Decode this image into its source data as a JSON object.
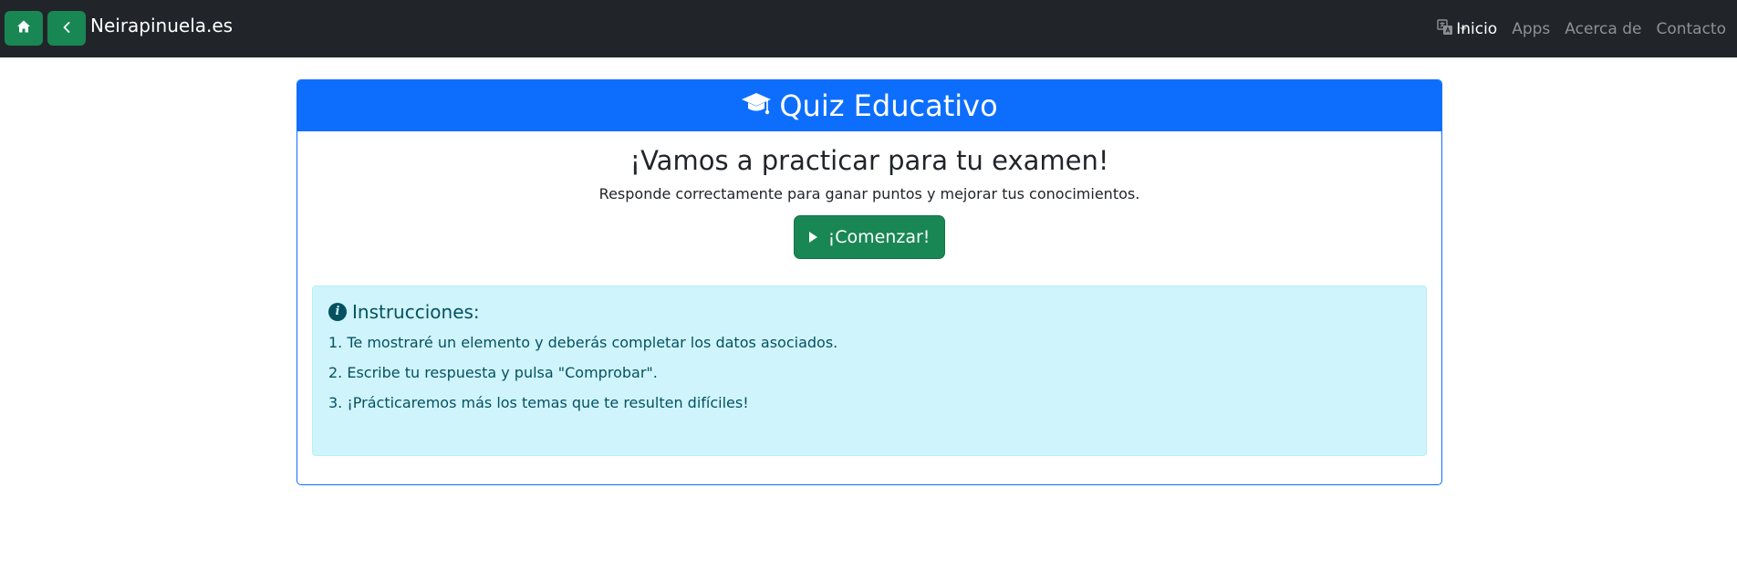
{
  "navbar": {
    "brand": "Neirapinuela.es",
    "links": [
      "Inicio",
      "Apps",
      "Acerca de",
      "Contacto"
    ],
    "icons": {
      "home": "home-icon",
      "back": "chevron-left-icon",
      "language": "translate-icon"
    },
    "colors": {
      "background": "#212529",
      "button": "#198754",
      "active_link": "#ffffff",
      "link": "#8c9196"
    }
  },
  "quiz": {
    "header_title": "Quiz Educativo",
    "header_icon": "graduation-cap-icon",
    "lead": "¡Vamos a practicar para tu examen!",
    "subtitle": "Responde correctamente para ganar puntos y mejorar tus conocimientos.",
    "start_button": "¡Comenzar!",
    "start_icon": "play-icon",
    "colors": {
      "header": "#0d6efd",
      "button": "#198754"
    }
  },
  "instructions": {
    "title": "Instrucciones:",
    "icon": "info-circle-icon",
    "items": [
      "1. Te mostraré un elemento y deberás completar los datos asociados.",
      "2. Escribe tu respuesta y pulsa \"Comprobar\".",
      "3. ¡Prácticaremos más los temas que te resulten difíciles!"
    ],
    "colors": {
      "background": "#cff4fc",
      "text": "#055160"
    }
  }
}
